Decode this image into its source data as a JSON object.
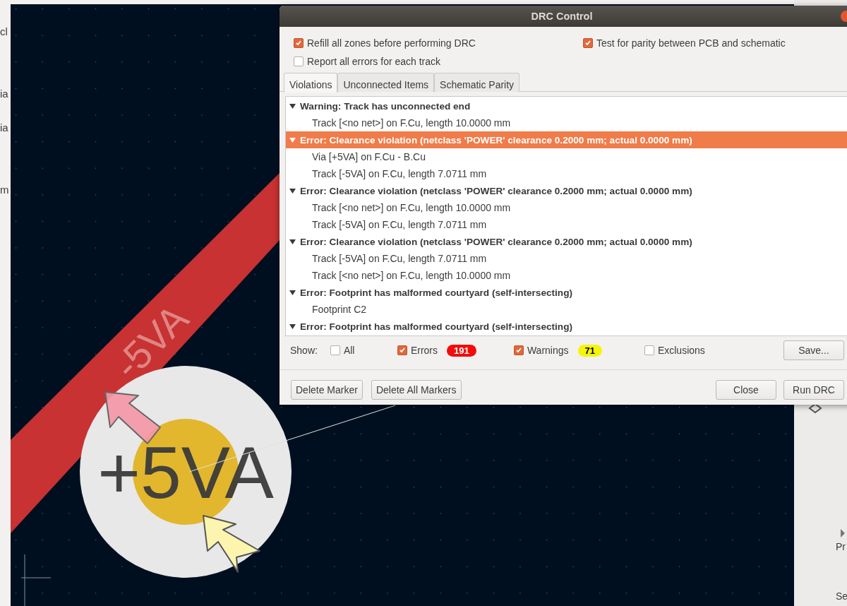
{
  "background": {
    "left_panel": {
      "labels": [
        "cl",
        "ia",
        "ia",
        "m"
      ]
    },
    "right_panel": {
      "labels": [
        "Pr",
        "Se"
      ]
    },
    "canvas": {
      "track_label": "-5VA",
      "via_label": "+5VA"
    }
  },
  "window": {
    "title": "DRC Control"
  },
  "options": [
    {
      "label": "Refill all zones before performing DRC",
      "checked": true
    },
    {
      "label": "Test for parity between PCB and schematic",
      "checked": true
    },
    {
      "label": "Report all errors for each track",
      "checked": false
    }
  ],
  "tabs": [
    {
      "label": "Violations",
      "selected": true
    },
    {
      "label": "Unconnected Items",
      "selected": false
    },
    {
      "label": "Schematic Parity",
      "selected": false
    }
  ],
  "violations": [
    {
      "text": "Warning: Track has unconnected end",
      "expanded": true,
      "selected": false,
      "children": [
        {
          "text": "Track [<no net>] on F.Cu, length 10.0000 mm"
        }
      ]
    },
    {
      "text": "Error: Clearance violation (netclass 'POWER' clearance 0.2000 mm; actual 0.0000 mm)",
      "expanded": true,
      "selected": true,
      "children": [
        {
          "text": "Via [+5VA] on F.Cu - B.Cu"
        },
        {
          "text": "Track [-5VA] on F.Cu, length 7.0711 mm"
        }
      ]
    },
    {
      "text": "Error: Clearance violation (netclass 'POWER' clearance 0.2000 mm; actual 0.0000 mm)",
      "expanded": true,
      "selected": false,
      "children": [
        {
          "text": "Track [<no net>] on F.Cu, length 10.0000 mm"
        },
        {
          "text": "Track [-5VA] on F.Cu, length 7.0711 mm"
        }
      ]
    },
    {
      "text": "Error: Clearance violation (netclass 'POWER' clearance 0.2000 mm; actual 0.0000 mm)",
      "expanded": true,
      "selected": false,
      "children": [
        {
          "text": "Track [-5VA] on F.Cu, length 7.0711 mm"
        },
        {
          "text": "Track [<no net>] on F.Cu, length 10.0000 mm"
        }
      ]
    },
    {
      "text": "Error: Footprint has malformed courtyard (self-intersecting)",
      "expanded": true,
      "selected": false,
      "children": [
        {
          "text": "Footprint C2"
        }
      ]
    },
    {
      "text": "Error: Footprint has malformed courtyard (self-intersecting)",
      "expanded": true,
      "selected": false
    }
  ],
  "show": {
    "label": "Show:",
    "filters": [
      {
        "label": "All",
        "checked": false
      },
      {
        "label": "Errors",
        "checked": true,
        "count": "191",
        "color": "#f20c0c"
      },
      {
        "label": "Warnings",
        "checked": true,
        "count": "71",
        "color": "#f5f50a"
      },
      {
        "label": "Exclusions",
        "checked": false
      }
    ],
    "save_button": "Save..."
  },
  "buttons_left": [
    "Delete Marker",
    "Delete All Markers"
  ],
  "buttons_right": [
    "Close",
    "Run DRC"
  ]
}
